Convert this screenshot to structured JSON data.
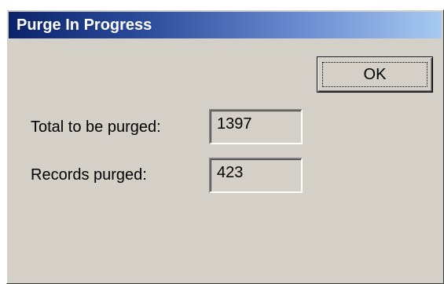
{
  "window": {
    "title": "Purge In Progress"
  },
  "buttons": {
    "ok_label": "OK"
  },
  "fields": [
    {
      "label": "Total to be purged:",
      "value": "1397"
    },
    {
      "label": "Records purged:",
      "value": "423"
    }
  ],
  "colors": {
    "dialog_face": "#d4d0c8",
    "titlebar_start": "#0a246a",
    "titlebar_end": "#a6caf0",
    "title_text": "#ffffff"
  }
}
